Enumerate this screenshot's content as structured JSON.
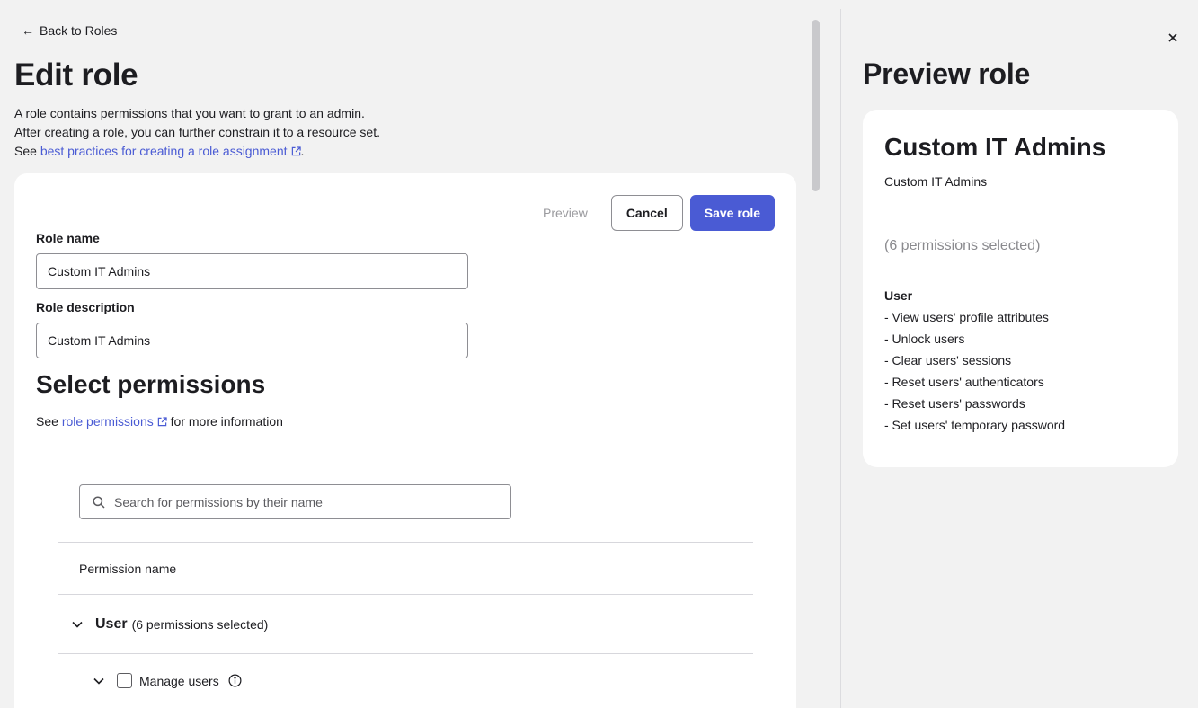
{
  "nav": {
    "back_label": "Back to Roles"
  },
  "page": {
    "title": "Edit role",
    "intro_line1": "A role contains permissions that you want to grant to an admin.",
    "intro_line2": "After creating a role, you can further constrain it to a resource set.",
    "intro_see": "See ",
    "intro_link": "best practices for creating a role assignment",
    "intro_end": "."
  },
  "toolbar": {
    "preview_label": "Preview",
    "cancel_label": "Cancel",
    "save_label": "Save role"
  },
  "form": {
    "role_name_label": "Role name",
    "role_name_value": "Custom IT Admins",
    "role_desc_label": "Role description",
    "role_desc_value": "Custom IT Admins"
  },
  "permissions": {
    "title": "Select permissions",
    "note_prefix": "See ",
    "note_link": "role permissions",
    "note_suffix": " for more information",
    "search_placeholder": "Search for permissions by their name",
    "column_header": "Permission name",
    "group_name": "User",
    "group_count": "(6 permissions selected)",
    "sub_label": "Manage users"
  },
  "preview": {
    "title": "Preview role",
    "role_name": "Custom IT Admins",
    "role_desc": "Custom IT Admins",
    "count": "(6 permissions selected)",
    "group": "User",
    "items": [
      "- View users' profile attributes",
      "- Unlock users",
      "- Clear users' sessions",
      "- Reset users' authenticators",
      "- Reset users' passwords",
      "- Set users' temporary password"
    ]
  },
  "colors": {
    "accent": "#4a5bd4",
    "background": "#f2f2f2",
    "muted": "#8a8a8e"
  },
  "icons": [
    "arrow-left-icon",
    "external-link-icon",
    "search-icon",
    "chevron-down-icon",
    "info-icon",
    "close-icon"
  ]
}
